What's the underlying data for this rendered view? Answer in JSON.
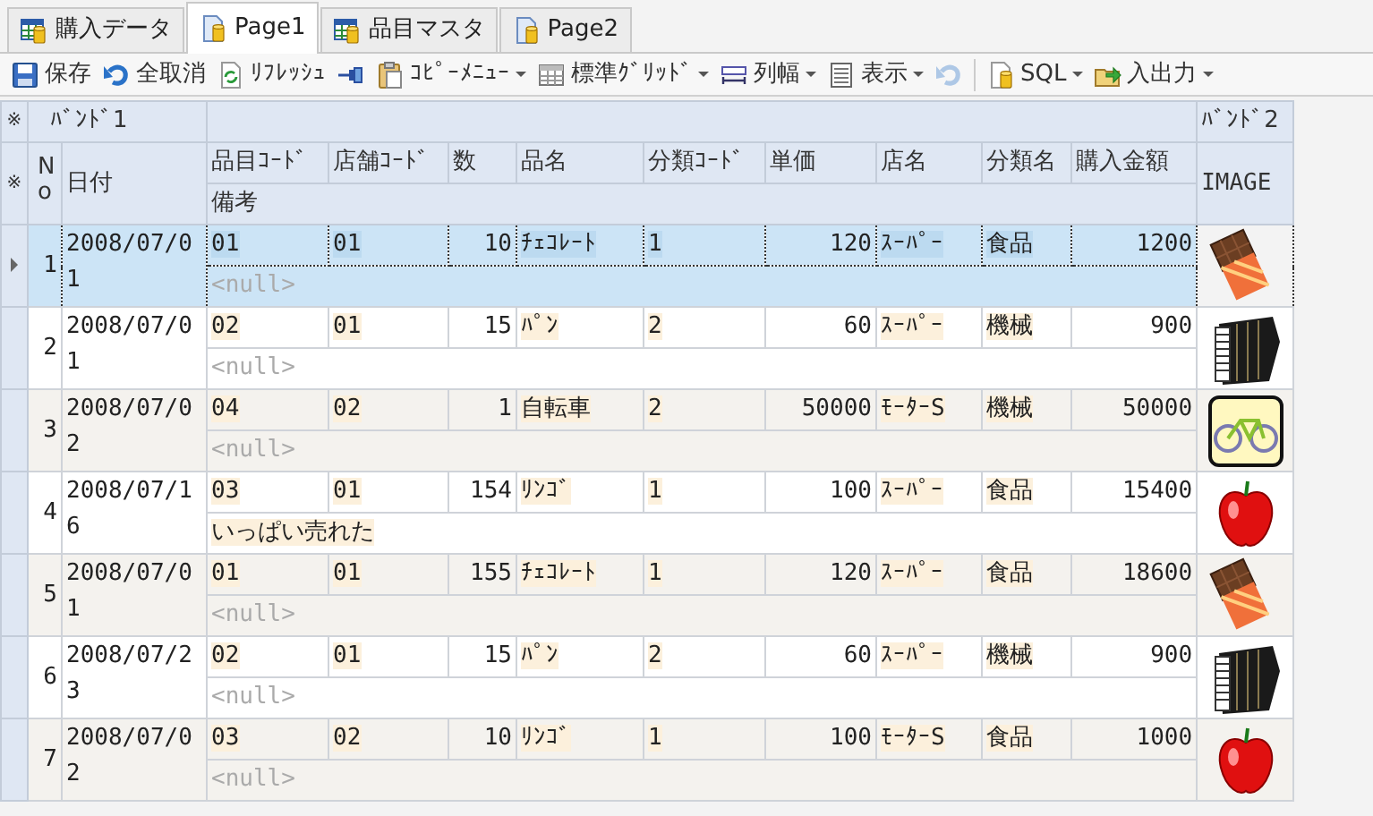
{
  "tabs": [
    {
      "label": "購入データ",
      "kind": "table",
      "selected": false
    },
    {
      "label": "Page1",
      "kind": "page",
      "selected": true
    },
    {
      "label": "品目マスタ",
      "kind": "table",
      "selected": false
    },
    {
      "label": "Page2",
      "kind": "page",
      "selected": false
    }
  ],
  "toolbar": [
    {
      "kind": "save",
      "label": "保存",
      "dropdown": false,
      "disabled": false
    },
    {
      "kind": "undo",
      "label": "全取消",
      "dropdown": false,
      "disabled": false
    },
    {
      "kind": "refresh",
      "label": "ﾘﾌﾚｯｼｭ",
      "dropdown": false,
      "disabled": false
    },
    {
      "kind": "pin",
      "dropdown": false,
      "disabled": false
    },
    {
      "kind": "copy",
      "label": "ｺﾋﾟｰﾒﾆｭｰ",
      "dropdown": true,
      "disabled": false
    },
    {
      "kind": "grid",
      "label": "標準ｸﾞﾘｯﾄﾞ",
      "dropdown": true,
      "disabled": false
    },
    {
      "kind": "width",
      "label": "列幅",
      "dropdown": true,
      "disabled": false
    },
    {
      "kind": "view",
      "label": "表示",
      "dropdown": true,
      "disabled": false
    },
    {
      "kind": "undo",
      "dropdown": false,
      "disabled": true
    },
    {
      "kind": "separator"
    },
    {
      "kind": "sql",
      "label": "SQL",
      "dropdown": true,
      "disabled": false
    },
    {
      "kind": "export",
      "label": "入出力",
      "dropdown": true,
      "disabled": false
    }
  ],
  "grid": {
    "band_mark": "※",
    "header_mark": "※",
    "bands": [
      "ﾊﾞﾝﾄﾞ1",
      "ﾊﾞﾝﾄﾞ2"
    ],
    "no_header": "No",
    "date_header": "日付",
    "columns": [
      {
        "label": "品目ｺｰﾄﾞ",
        "kind": "text",
        "lookup": true
      },
      {
        "label": "店舗ｺｰﾄﾞ",
        "kind": "text",
        "lookup": true
      },
      {
        "label": "数",
        "kind": "number",
        "lookup": false
      },
      {
        "label": "品名",
        "kind": "text",
        "lookup": true
      },
      {
        "label": "分類ｺｰﾄﾞ",
        "kind": "text",
        "lookup": true
      },
      {
        "label": "単価",
        "kind": "number",
        "lookup": false
      },
      {
        "label": "店名",
        "kind": "text",
        "lookup": true
      },
      {
        "label": "分類名",
        "kind": "text",
        "lookup": true
      },
      {
        "label": "購入金額",
        "kind": "number",
        "lookup": false
      }
    ],
    "remarks_header": "備考",
    "image_header": "IMAGE",
    "rows": [
      {
        "no": "1",
        "date": "2008/07/01",
        "values": [
          "01",
          "01",
          "10",
          "ﾁｪｺﾚｰﾄ",
          "1",
          "120",
          "ｽｰﾊﾟｰ",
          "食品",
          "1200"
        ],
        "remarks": "<null>",
        "null_remarks": true,
        "kind": "chocolate",
        "selected": true
      },
      {
        "no": "2",
        "date": "2008/07/01",
        "values": [
          "02",
          "01",
          "15",
          "ﾊﾟﾝ",
          "2",
          "60",
          "ｽｰﾊﾟｰ",
          "機械",
          "900"
        ],
        "remarks": "<null>",
        "null_remarks": true,
        "kind": "accordion",
        "selected": false
      },
      {
        "no": "3",
        "date": "2008/07/02",
        "values": [
          "04",
          "02",
          "1",
          "自転車",
          "2",
          "50000",
          "ﾓｰﾀｰS",
          "機械",
          "50000"
        ],
        "remarks": "<null>",
        "null_remarks": true,
        "kind": "bicycle",
        "selected": false
      },
      {
        "no": "4",
        "date": "2008/07/16",
        "values": [
          "03",
          "01",
          "154",
          "ﾘﾝｺﾞ",
          "1",
          "100",
          "ｽｰﾊﾟｰ",
          "食品",
          "15400"
        ],
        "remarks": "いっぱい売れた",
        "null_remarks": false,
        "kind": "apple",
        "selected": false
      },
      {
        "no": "5",
        "date": "2008/07/01",
        "values": [
          "01",
          "01",
          "155",
          "ﾁｪｺﾚｰﾄ",
          "1",
          "120",
          "ｽｰﾊﾟｰ",
          "食品",
          "18600"
        ],
        "remarks": "<null>",
        "null_remarks": true,
        "kind": "chocolate",
        "selected": false
      },
      {
        "no": "6",
        "date": "2008/07/23",
        "values": [
          "02",
          "01",
          "15",
          "ﾊﾟﾝ",
          "2",
          "60",
          "ｽｰﾊﾟｰ",
          "機械",
          "900"
        ],
        "remarks": "<null>",
        "null_remarks": true,
        "kind": "accordion",
        "selected": false
      },
      {
        "no": "7",
        "date": "2008/07/02",
        "values": [
          "03",
          "02",
          "10",
          "ﾘﾝｺﾞ",
          "1",
          "100",
          "ﾓｰﾀｰS",
          "食品",
          "1000"
        ],
        "remarks": "<null>",
        "null_remarks": true,
        "kind": "apple",
        "selected": false
      }
    ]
  }
}
